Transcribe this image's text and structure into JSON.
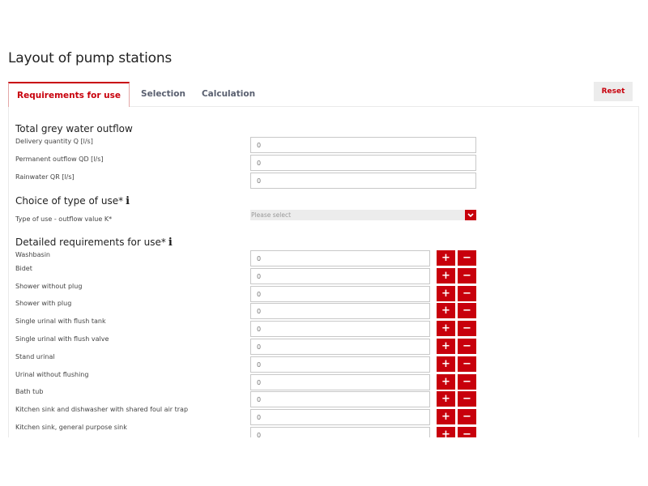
{
  "page": {
    "title": "Layout of pump stations"
  },
  "tabs": [
    {
      "label": "Requirements for use",
      "active": true
    },
    {
      "label": "Selection",
      "active": false
    },
    {
      "label": "Calculation",
      "active": false
    }
  ],
  "toolbar": {
    "reset_label": "Reset"
  },
  "colors": {
    "accent": "#c8000c",
    "tab_text": "#5a6070",
    "input_border": "#c8c8c8",
    "select_bg": "#ececec"
  },
  "grey_water": {
    "heading": "Total grey water outflow",
    "fields": [
      {
        "label": "Delivery quantity Q [l/s]",
        "value": "",
        "placeholder": "0"
      },
      {
        "label": "Permanent outflow QD [l/s]",
        "value": "",
        "placeholder": "0"
      },
      {
        "label": "Rainwater QR [l/s]",
        "value": "",
        "placeholder": "0"
      }
    ]
  },
  "type_of_use": {
    "heading": "Choice of type of use*",
    "info_icon": "info-icon",
    "field_label": "Type of use - outflow value K*",
    "select_value": "Please select",
    "arrow_icon": "chevron-down-icon"
  },
  "detailed": {
    "heading": "Detailed requirements for use*",
    "info_icon": "info-icon",
    "plus_label": "+",
    "minus_label": "−",
    "items": [
      {
        "label": "Washbasin",
        "placeholder": "0"
      },
      {
        "label": "Bidet",
        "placeholder": "0"
      },
      {
        "label": "Shower without plug",
        "placeholder": "0"
      },
      {
        "label": "Shower with plug",
        "placeholder": "0"
      },
      {
        "label": "Single urinal with flush tank",
        "placeholder": "0"
      },
      {
        "label": "Single urinal with flush valve",
        "placeholder": "0"
      },
      {
        "label": "Stand urinal",
        "placeholder": "0"
      },
      {
        "label": "Urinal without flushing",
        "placeholder": "0"
      },
      {
        "label": "Bath tub",
        "placeholder": "0"
      },
      {
        "label": "Kitchen sink and dishwasher with shared foul air trap",
        "placeholder": "0"
      },
      {
        "label": "Kitchen sink, general purpose sink",
        "placeholder": "0"
      }
    ]
  }
}
